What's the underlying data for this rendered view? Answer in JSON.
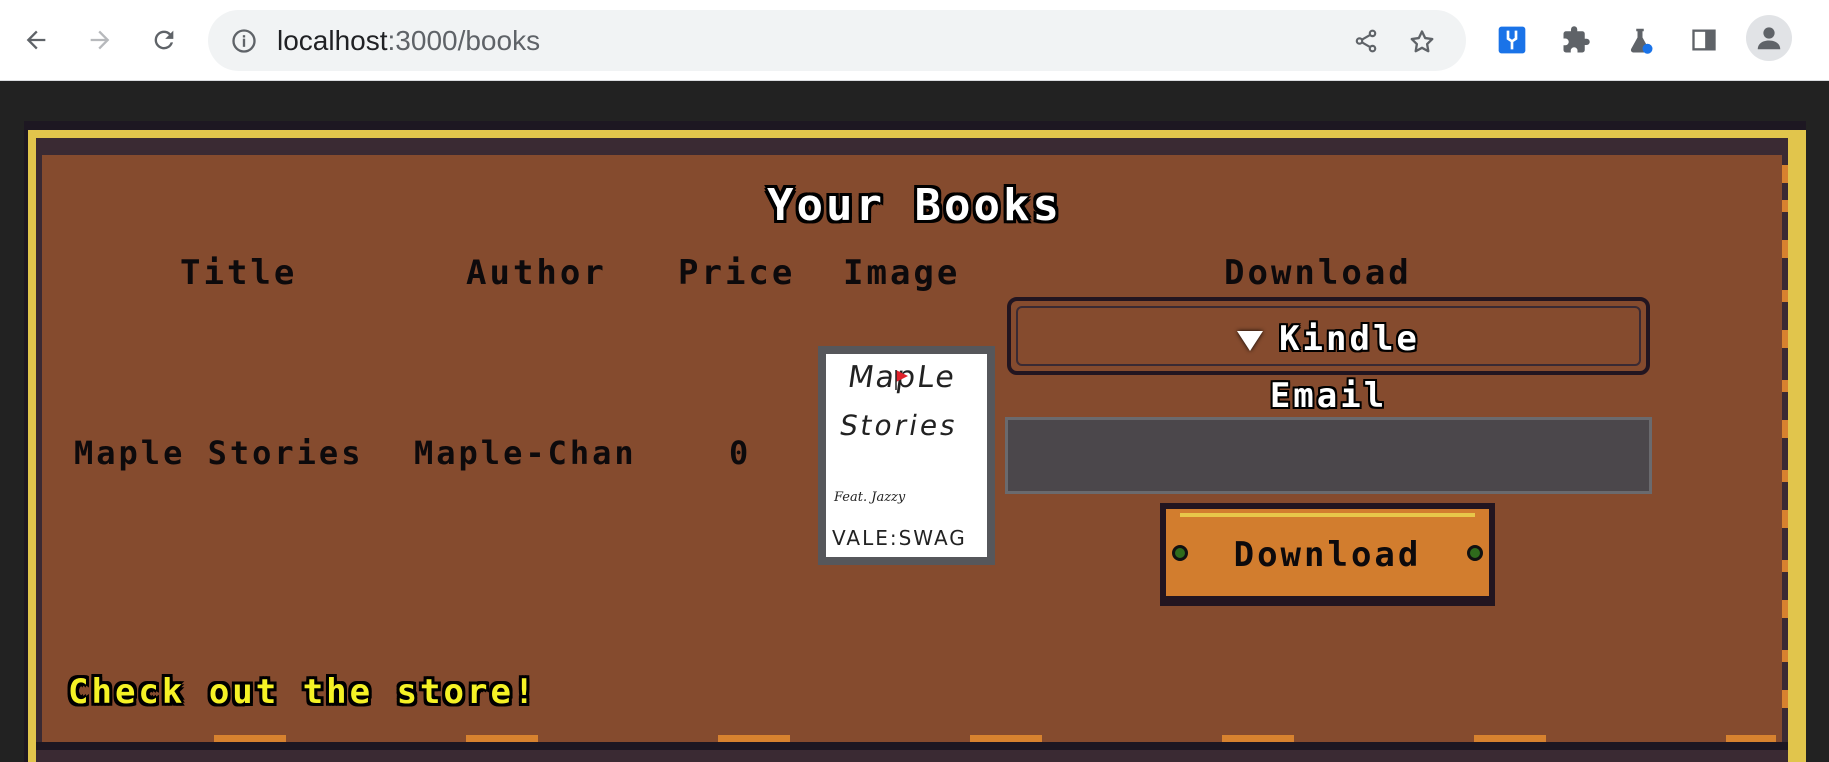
{
  "browser": {
    "url_host": "localhost",
    "url_path": ":3000/books",
    "icons": [
      "back-icon",
      "forward-icon",
      "reload-icon",
      "site-info-icon",
      "share-icon",
      "bookmark-star-icon",
      "extension-devtools-icon",
      "extensions-puzzle-icon",
      "labs-flask-icon",
      "side-panel-icon",
      "profile-icon"
    ]
  },
  "page": {
    "title": "Your Books",
    "table": {
      "headers": [
        "Title",
        "Author",
        "Price",
        "Image",
        "Download"
      ],
      "rows": [
        {
          "title": "Maple Stories",
          "author": "Maple-Chan",
          "price": "0",
          "image": {
            "line1": "MapLe",
            "line2": "Stories",
            "feat": "Feat. Jazzy",
            "footer": "VALE:SWAG"
          }
        }
      ]
    },
    "download": {
      "format_selected": "Kindle",
      "email_label": "Email",
      "email_value": "",
      "button_label": "Download"
    },
    "store_link": "Check out the store!"
  },
  "colors": {
    "background": "#222222",
    "panel": "#854b2e",
    "gold_border": "#e1c54c",
    "button": "#d27d2e",
    "link": "#f5f225",
    "input": "#4b474b"
  }
}
